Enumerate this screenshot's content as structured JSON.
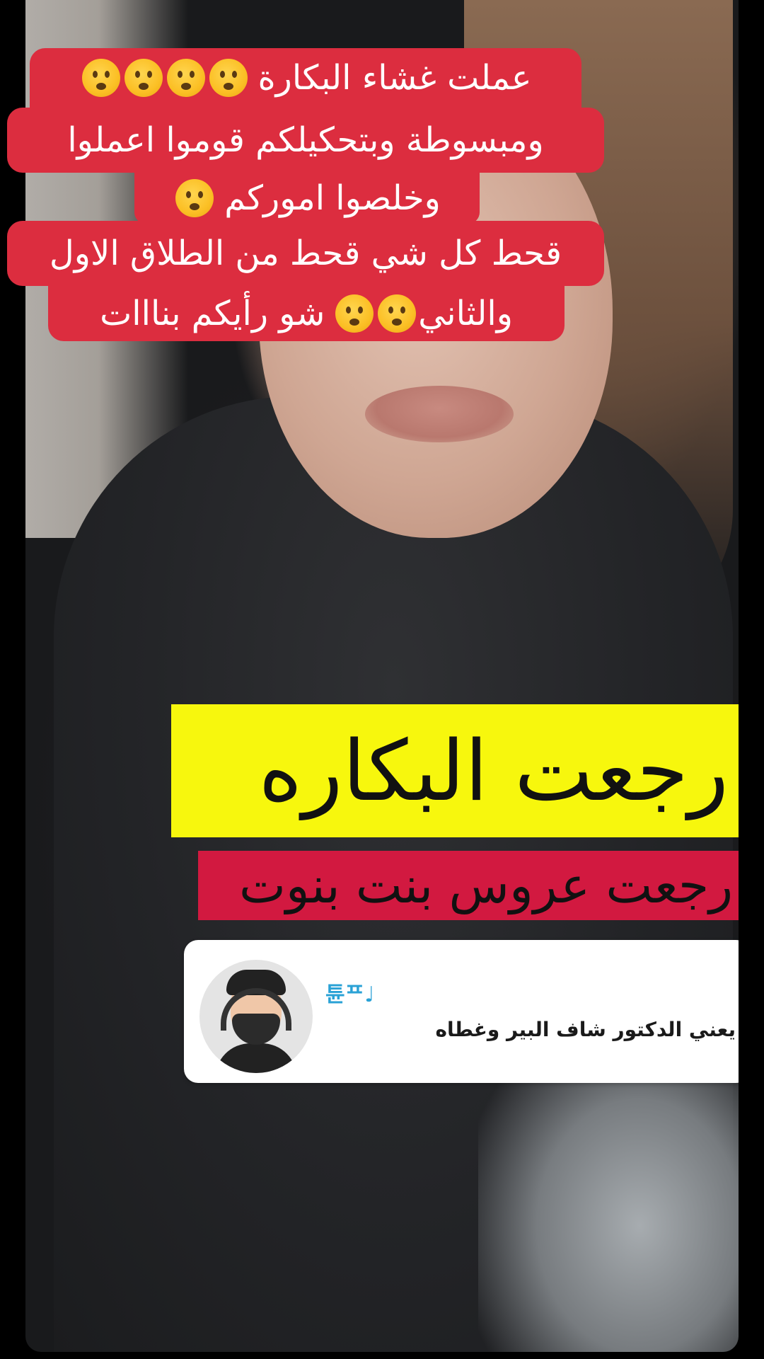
{
  "caption": {
    "line1": "عملت غشاء البكارة",
    "line2": "ومبسوطة  وبتحكيلكم قوموا اعملوا",
    "line3": "وخلصوا اموركم",
    "line4": "قحط كل شي قحط من الطلاق الاول",
    "line5a": "والثاني",
    "line5b": "شو رأيكم بنااات",
    "emoji": "worried-face-emoji",
    "background_color": "#dc2d3f"
  },
  "video_text": {
    "title": "رجعت البكاره",
    "subtitle": "رجعت عروس  بنت بنوت",
    "title_bg": "#f7f70d",
    "subtitle_bg": "#d21940"
  },
  "comment": {
    "username": "튠ᄑ♩",
    "text": "يعني الدكتور شاف البير وغطاه"
  }
}
